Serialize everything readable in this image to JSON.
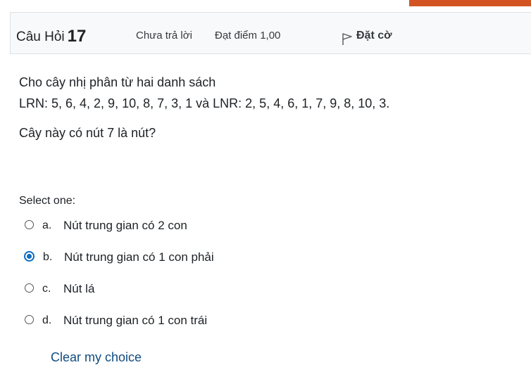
{
  "colors": {
    "accent_bar": "#d35423",
    "header_bg": "#f8f9fa",
    "link": "#0f4c81",
    "radio_selected": "#0f6cbf"
  },
  "header": {
    "question_label": "Câu Hỏi",
    "question_number": "17",
    "state": "Chưa trả lời",
    "grade": "Đạt điểm 1,00",
    "flag_icon": "flag-outline-icon",
    "flag_label": "Đặt cờ"
  },
  "question": {
    "line1": "Cho cây nhị phân từ hai danh sách",
    "line2": "LRN: 5, 6, 4, 2, 9, 10, 8, 7, 3, 1 và LNR: 2, 5, 4, 6, 1, 7, 9, 8, 10, 3.",
    "line3": "Cây này có nút 7 là nút?"
  },
  "prompt": "Select one:",
  "answers": [
    {
      "letter": "a.",
      "text": "Nút trung gian có 2 con",
      "selected": false
    },
    {
      "letter": "b.",
      "text": "Nút trung gian có 1 con phải",
      "selected": true
    },
    {
      "letter": "c.",
      "text": "Nút lá",
      "selected": false
    },
    {
      "letter": "d.",
      "text": "Nút trung gian có 1 con trái",
      "selected": false
    }
  ],
  "clear_label": "Clear my choice"
}
